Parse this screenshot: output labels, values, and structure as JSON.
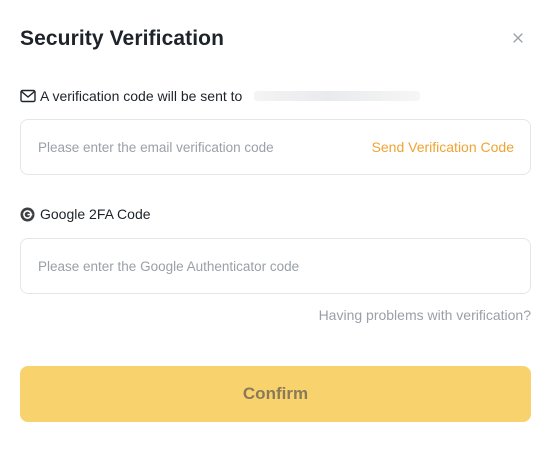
{
  "dialog": {
    "title": "Security Verification",
    "close_icon": "close-icon"
  },
  "email": {
    "label": "A verification code will be sent to",
    "icon": "envelope-icon",
    "input_placeholder": "Please enter the email verification code",
    "input_value": "",
    "send_code_label": "Send Verification Code"
  },
  "google_2fa": {
    "label": "Google 2FA Code",
    "icon": "google-authenticator-icon",
    "input_placeholder": "Please enter the Google Authenticator code",
    "input_value": ""
  },
  "help": {
    "problems_link": "Having problems with verification?"
  },
  "actions": {
    "confirm_label": "Confirm"
  },
  "colors": {
    "accent": "#f0a332",
    "confirm_bg": "#f8d26d",
    "muted_text": "#9aa0a8",
    "border": "#e4e6eb"
  }
}
